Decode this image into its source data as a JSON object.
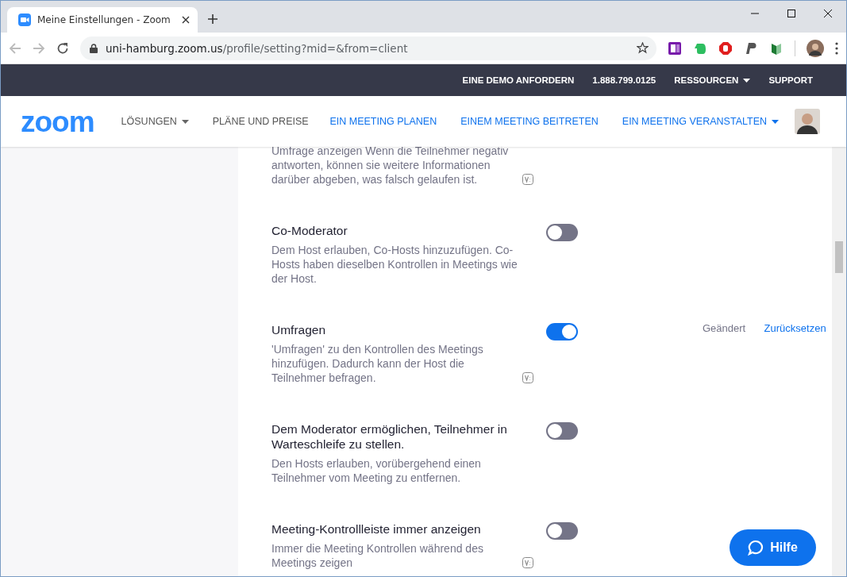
{
  "window": {
    "tab_title": "Meine Einstellungen - Zoom",
    "url_host": "uni-hamburg.zoom.us",
    "url_path": "/profile/setting?mid=&from=client"
  },
  "top_bar": {
    "links": [
      {
        "label": "EINE DEMO ANFORDERN",
        "dropdown": false
      },
      {
        "label": "1.888.799.0125",
        "dropdown": false
      },
      {
        "label": "RESSOURCEN",
        "dropdown": true
      },
      {
        "label": "SUPPORT",
        "dropdown": false
      }
    ]
  },
  "nav": {
    "logo": "zoom",
    "left_links": [
      {
        "label": "LÖSUNGEN",
        "dropdown": true
      },
      {
        "label": "PLÄNE UND PREISE",
        "dropdown": false
      }
    ],
    "right_links": [
      {
        "label": "EIN MEETING PLANEN",
        "dropdown": false
      },
      {
        "label": "EINEM MEETING BEITRETEN",
        "dropdown": false
      },
      {
        "label": "EIN MEETING VERANSTALTEN",
        "dropdown": true
      }
    ]
  },
  "settings": [
    {
      "description": "Umfrage anzeigen Wenn die Teilnehmer negativ antworten, können sie weitere Informationen darüber abgeben, was falsch gelaufen ist.",
      "note_icon": true
    },
    {
      "title": "Co-Moderator",
      "description": "Dem Host erlauben, Co-Hosts hinzuzufügen. Co-Hosts haben dieselben Kontrollen in Meetings wie der Host.",
      "note_icon": false,
      "on": false
    },
    {
      "title": "Umfragen",
      "description": "'Umfragen' zu den Kontrollen des Meetings hinzufügen. Dadurch kann der Host die Teilnehmer befragen.",
      "note_icon": true,
      "on": true,
      "changed_label": "Geändert",
      "reset_link": "Zurücksetzen"
    },
    {
      "title": "Dem Moderator ermöglichen, Teilnehmer in Warteschleife zu stellen.",
      "description": "Den Hosts erlauben, vorübergehend einen Teilnehmer vom Meeting zu entfernen.",
      "note_icon": false,
      "on": false
    },
    {
      "title": "Meeting-Kontrollleiste immer anzeigen",
      "description": "Immer die Meeting Kontrollen während des Meetings zeigen",
      "note_icon": true,
      "on": false
    }
  ],
  "help_button": {
    "label": "Hilfe"
  }
}
